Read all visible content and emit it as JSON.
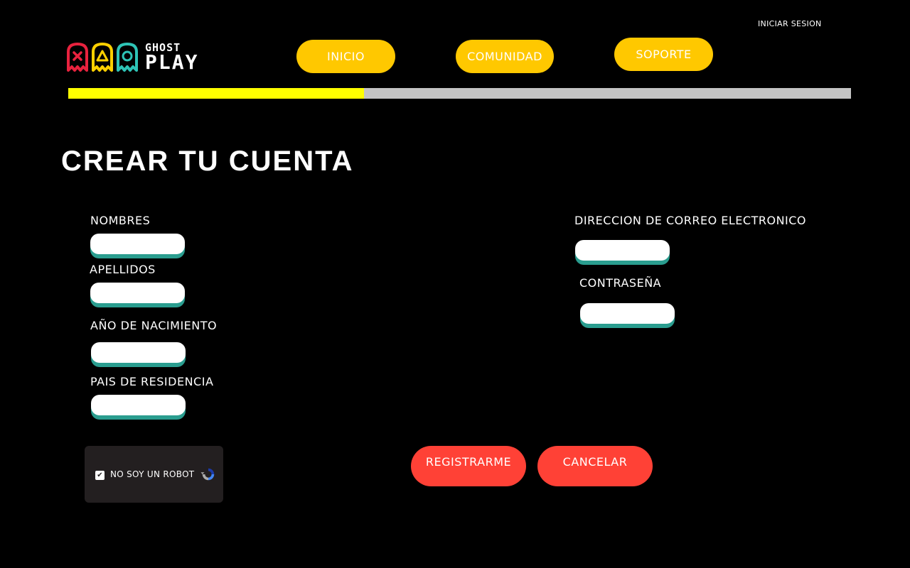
{
  "header": {
    "login_link": "INICIAR SESION",
    "logo": {
      "line1": "GHOST",
      "line2": "PLAY"
    },
    "nav": [
      {
        "label": "INICIO"
      },
      {
        "label": "COMUNIDAD"
      },
      {
        "label": "SOPORTE"
      }
    ]
  },
  "progress": {
    "fraction": 0.378,
    "fill_color": "#ffff00",
    "track_color": "#c4c4c4"
  },
  "form": {
    "title": "CREAR TU CUENTA",
    "fields": {
      "nombres": {
        "label": "NOMBRES",
        "value": "",
        "placeholder": ""
      },
      "apellidos": {
        "label": "APELLIDOS",
        "value": "",
        "placeholder": ""
      },
      "nacimiento": {
        "label": "AÑO DE NACIMIENTO",
        "value": "",
        "placeholder": ""
      },
      "pais": {
        "label": "PAIS DE RESIDENCIA",
        "value": "",
        "placeholder": ""
      },
      "correo": {
        "label": "DIRECCION DE CORREO ELECTRONICO",
        "value": "",
        "placeholder": ""
      },
      "contrasena": {
        "label": "CONTRASEÑA",
        "value": "",
        "placeholder": ""
      }
    },
    "captcha": {
      "label": "NO SOY UN ROBOT",
      "checked": true,
      "check_glyph": "✔"
    },
    "buttons": {
      "register": "REGISTRARME",
      "cancel": "CANCELAR"
    }
  },
  "colors": {
    "background": "#000000",
    "nav_accent": "#ffc800",
    "action_accent": "#ff4136",
    "field_shadow": "#2a9d8f",
    "ghost_red": "#e8223e",
    "ghost_yellow": "#ffd000",
    "ghost_teal": "#2ec4b6"
  }
}
